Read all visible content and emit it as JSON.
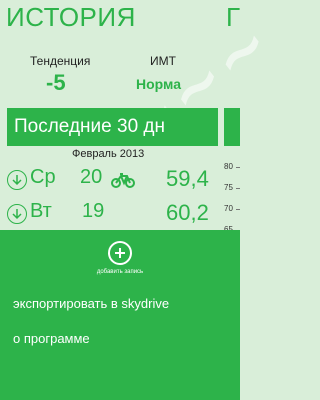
{
  "header": {
    "title": "ИСТОРИЯ",
    "next_title": "Г"
  },
  "stats": {
    "tendency_label": "Тенденция",
    "tendency_value": "-5",
    "bmi_label": "ИМТ",
    "bmi_value": "Норма"
  },
  "period": {
    "label": "Последние 30 дн"
  },
  "month_label": "Февраль 2013",
  "entries": [
    {
      "day": "Ср",
      "date": "20",
      "weight": "59,4",
      "activity_icon": "bicycle-icon"
    },
    {
      "day": "Вт",
      "date": "19",
      "weight": "60,2"
    }
  ],
  "side_axis": {
    "ticks": [
      "80",
      "75",
      "70",
      "65"
    ]
  },
  "app_bar": {
    "add_label": "добавить запись",
    "menu": [
      {
        "label": "экспортировать в skydrive"
      },
      {
        "label": "о программе"
      }
    ]
  },
  "colors": {
    "accent": "#2db34a",
    "background": "#d9eed9",
    "text_on_accent": "#ffffff"
  }
}
